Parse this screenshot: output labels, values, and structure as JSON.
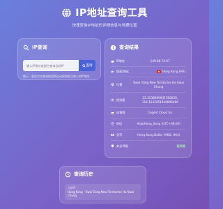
{
  "header": {
    "title": "IP地址查询工具",
    "subtitle": "快速查询IP地址的详细信息与地理位置"
  },
  "search": {
    "title": "IP查询",
    "placeholder": "输入IP地址或留空查询当前IP",
    "button_label": "查询",
    "hint": "提示：留空点击查询按钮将自动获取您当前公网IP地址"
  },
  "result": {
    "title": "查询结果",
    "rows": [
      {
        "icon": "ip-icon",
        "label": "IP地址",
        "value": "149.88.74.67"
      },
      {
        "icon": "flag-icon",
        "label": "国家/地区",
        "value": "Hong Kong (HK)"
      },
      {
        "icon": "location-icon",
        "label": "位置",
        "value": "Kwai Tsing New Territories Ha Kwai Chung"
      },
      {
        "icon": "coordinates-icon",
        "label": "经纬度",
        "value": "22.3538699941782630, 114.1242051944806469"
      },
      {
        "icon": "network-icon",
        "label": "运营商",
        "value": "Cogent Cloud Inc"
      },
      {
        "icon": "clock-icon",
        "label": "时区",
        "value": "Asia/Hong_Kong (UTC+08:00)"
      },
      {
        "icon": "currency-icon",
        "label": "货币",
        "value": "Hong Kong Dollar (HKD, HK$)"
      },
      {
        "icon": "shield-icon",
        "label": "安全评级",
        "value": "低风险"
      }
    ]
  },
  "history": {
    "title": "查询历史",
    "items": [
      {
        "ip": "当前IP",
        "location": "Hong Kong - Kwai Tsing New Territories Ha Kwai Chung"
      }
    ]
  },
  "colors": {
    "accent": "#4a63d8",
    "safe": "#a7f3b2",
    "background_start": "#6a7fdc",
    "background_end": "#7651b5"
  }
}
